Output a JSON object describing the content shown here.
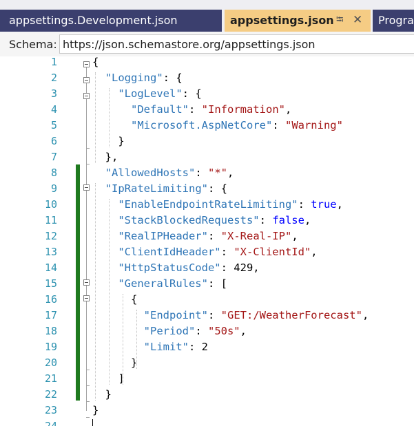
{
  "tabs": [
    {
      "label": "appsettings.Development.json",
      "active": false
    },
    {
      "label": "appsettings.json",
      "active": true,
      "pin_icon": "pin-icon",
      "close_icon": "close-icon"
    },
    {
      "label": "Progra",
      "active": false
    }
  ],
  "schema": {
    "label": "Schema:",
    "value": "https://json.schemastore.org/appsettings.json"
  },
  "colors": {
    "key": "#2e75b6",
    "string": "#a31515",
    "keyword": "#0000ff",
    "line_number": "#2b91af",
    "change_bar": "#1f7a1f",
    "active_tab": "#f5cc84",
    "inactive_tab": "#3b3f6e"
  },
  "editor": {
    "lines": [
      {
        "num": "1",
        "tokens": [
          {
            "t": "p",
            "v": "{"
          }
        ]
      },
      {
        "num": "2",
        "tokens": [
          {
            "t": "p",
            "v": "  "
          },
          {
            "t": "k",
            "v": "\"Logging\""
          },
          {
            "t": "p",
            "v": ": {"
          }
        ]
      },
      {
        "num": "3",
        "tokens": [
          {
            "t": "p",
            "v": "    "
          },
          {
            "t": "k",
            "v": "\"LogLevel\""
          },
          {
            "t": "p",
            "v": ": {"
          }
        ]
      },
      {
        "num": "4",
        "tokens": [
          {
            "t": "p",
            "v": "      "
          },
          {
            "t": "k",
            "v": "\"Default\""
          },
          {
            "t": "p",
            "v": ": "
          },
          {
            "t": "s",
            "v": "\"Information\""
          },
          {
            "t": "p",
            "v": ","
          }
        ]
      },
      {
        "num": "5",
        "tokens": [
          {
            "t": "p",
            "v": "      "
          },
          {
            "t": "k",
            "v": "\"Microsoft.AspNetCore\""
          },
          {
            "t": "p",
            "v": ": "
          },
          {
            "t": "s",
            "v": "\"Warning\""
          }
        ]
      },
      {
        "num": "6",
        "tokens": [
          {
            "t": "p",
            "v": "    }"
          }
        ]
      },
      {
        "num": "7",
        "tokens": [
          {
            "t": "p",
            "v": "  },"
          }
        ]
      },
      {
        "num": "8",
        "tokens": [
          {
            "t": "p",
            "v": "  "
          },
          {
            "t": "k",
            "v": "\"AllowedHosts\""
          },
          {
            "t": "p",
            "v": ": "
          },
          {
            "t": "s",
            "v": "\"*\""
          },
          {
            "t": "p",
            "v": ","
          }
        ]
      },
      {
        "num": "9",
        "tokens": [
          {
            "t": "p",
            "v": "  "
          },
          {
            "t": "k",
            "v": "\"IpRateLimiting\""
          },
          {
            "t": "p",
            "v": ": {"
          }
        ]
      },
      {
        "num": "10",
        "tokens": [
          {
            "t": "p",
            "v": "    "
          },
          {
            "t": "k",
            "v": "\"EnableEndpointRateLimiting\""
          },
          {
            "t": "p",
            "v": ": "
          },
          {
            "t": "b",
            "v": "true"
          },
          {
            "t": "p",
            "v": ","
          }
        ]
      },
      {
        "num": "11",
        "tokens": [
          {
            "t": "p",
            "v": "    "
          },
          {
            "t": "k",
            "v": "\"StackBlockedRequests\""
          },
          {
            "t": "p",
            "v": ": "
          },
          {
            "t": "b",
            "v": "false"
          },
          {
            "t": "p",
            "v": ","
          }
        ]
      },
      {
        "num": "12",
        "tokens": [
          {
            "t": "p",
            "v": "    "
          },
          {
            "t": "k",
            "v": "\"RealIPHeader\""
          },
          {
            "t": "p",
            "v": ": "
          },
          {
            "t": "s",
            "v": "\"X-Real-IP\""
          },
          {
            "t": "p",
            "v": ","
          }
        ]
      },
      {
        "num": "13",
        "tokens": [
          {
            "t": "p",
            "v": "    "
          },
          {
            "t": "k",
            "v": "\"ClientIdHeader\""
          },
          {
            "t": "p",
            "v": ": "
          },
          {
            "t": "s",
            "v": "\"X-ClientId\""
          },
          {
            "t": "p",
            "v": ","
          }
        ]
      },
      {
        "num": "14",
        "tokens": [
          {
            "t": "p",
            "v": "    "
          },
          {
            "t": "k",
            "v": "\"HttpStatusCode\""
          },
          {
            "t": "p",
            "v": ": 429,"
          }
        ]
      },
      {
        "num": "15",
        "tokens": [
          {
            "t": "p",
            "v": "    "
          },
          {
            "t": "k",
            "v": "\"GeneralRules\""
          },
          {
            "t": "p",
            "v": ": ["
          }
        ]
      },
      {
        "num": "16",
        "tokens": [
          {
            "t": "p",
            "v": "      {"
          }
        ]
      },
      {
        "num": "17",
        "tokens": [
          {
            "t": "p",
            "v": "        "
          },
          {
            "t": "k",
            "v": "\"Endpoint\""
          },
          {
            "t": "p",
            "v": ": "
          },
          {
            "t": "s",
            "v": "\"GET:/WeatherForecast\""
          },
          {
            "t": "p",
            "v": ","
          }
        ]
      },
      {
        "num": "18",
        "tokens": [
          {
            "t": "p",
            "v": "        "
          },
          {
            "t": "k",
            "v": "\"Period\""
          },
          {
            "t": "p",
            "v": ": "
          },
          {
            "t": "s",
            "v": "\"50s\""
          },
          {
            "t": "p",
            "v": ","
          }
        ]
      },
      {
        "num": "19",
        "tokens": [
          {
            "t": "p",
            "v": "        "
          },
          {
            "t": "k",
            "v": "\"Limit\""
          },
          {
            "t": "p",
            "v": ": 2"
          }
        ]
      },
      {
        "num": "20",
        "tokens": [
          {
            "t": "p",
            "v": "      }"
          }
        ]
      },
      {
        "num": "21",
        "tokens": [
          {
            "t": "p",
            "v": "    ]"
          }
        ]
      },
      {
        "num": "22",
        "tokens": [
          {
            "t": "p",
            "v": "  }"
          }
        ]
      },
      {
        "num": "23",
        "tokens": [
          {
            "t": "p",
            "v": "}"
          }
        ]
      },
      {
        "num": "24",
        "tokens": []
      }
    ]
  }
}
